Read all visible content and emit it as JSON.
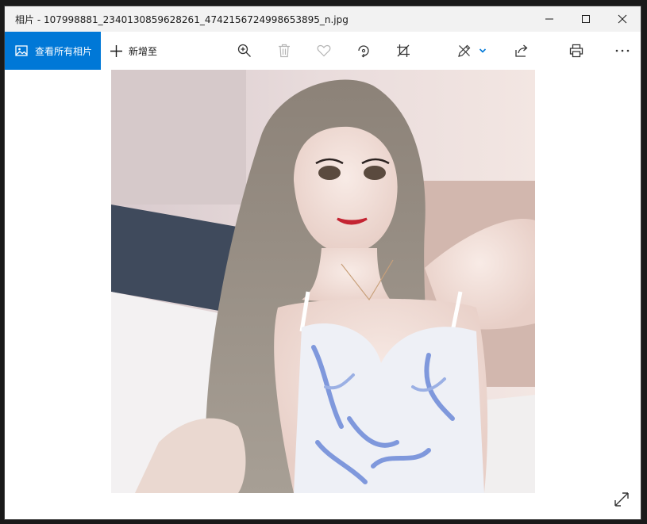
{
  "window": {
    "title": "相片 - 107998881_2340130859628261_4742156724998653895_n.jpg",
    "controls": [
      "minimize-icon",
      "maximize-icon",
      "close-icon"
    ]
  },
  "toolbar": {
    "view_all_label": "查看所有相片",
    "add_to_label": "新增至",
    "icons": [
      "zoom-in-icon",
      "delete-icon",
      "favorite-icon",
      "rotate-icon",
      "crop-icon",
      "edit-icon",
      "share-icon",
      "print-icon",
      "more-icon"
    ]
  },
  "colors": {
    "accent": "#0078d7",
    "titlebar": "#f2f2f2",
    "icon": "#333333",
    "icon_disabled": "#b4b4b4"
  }
}
